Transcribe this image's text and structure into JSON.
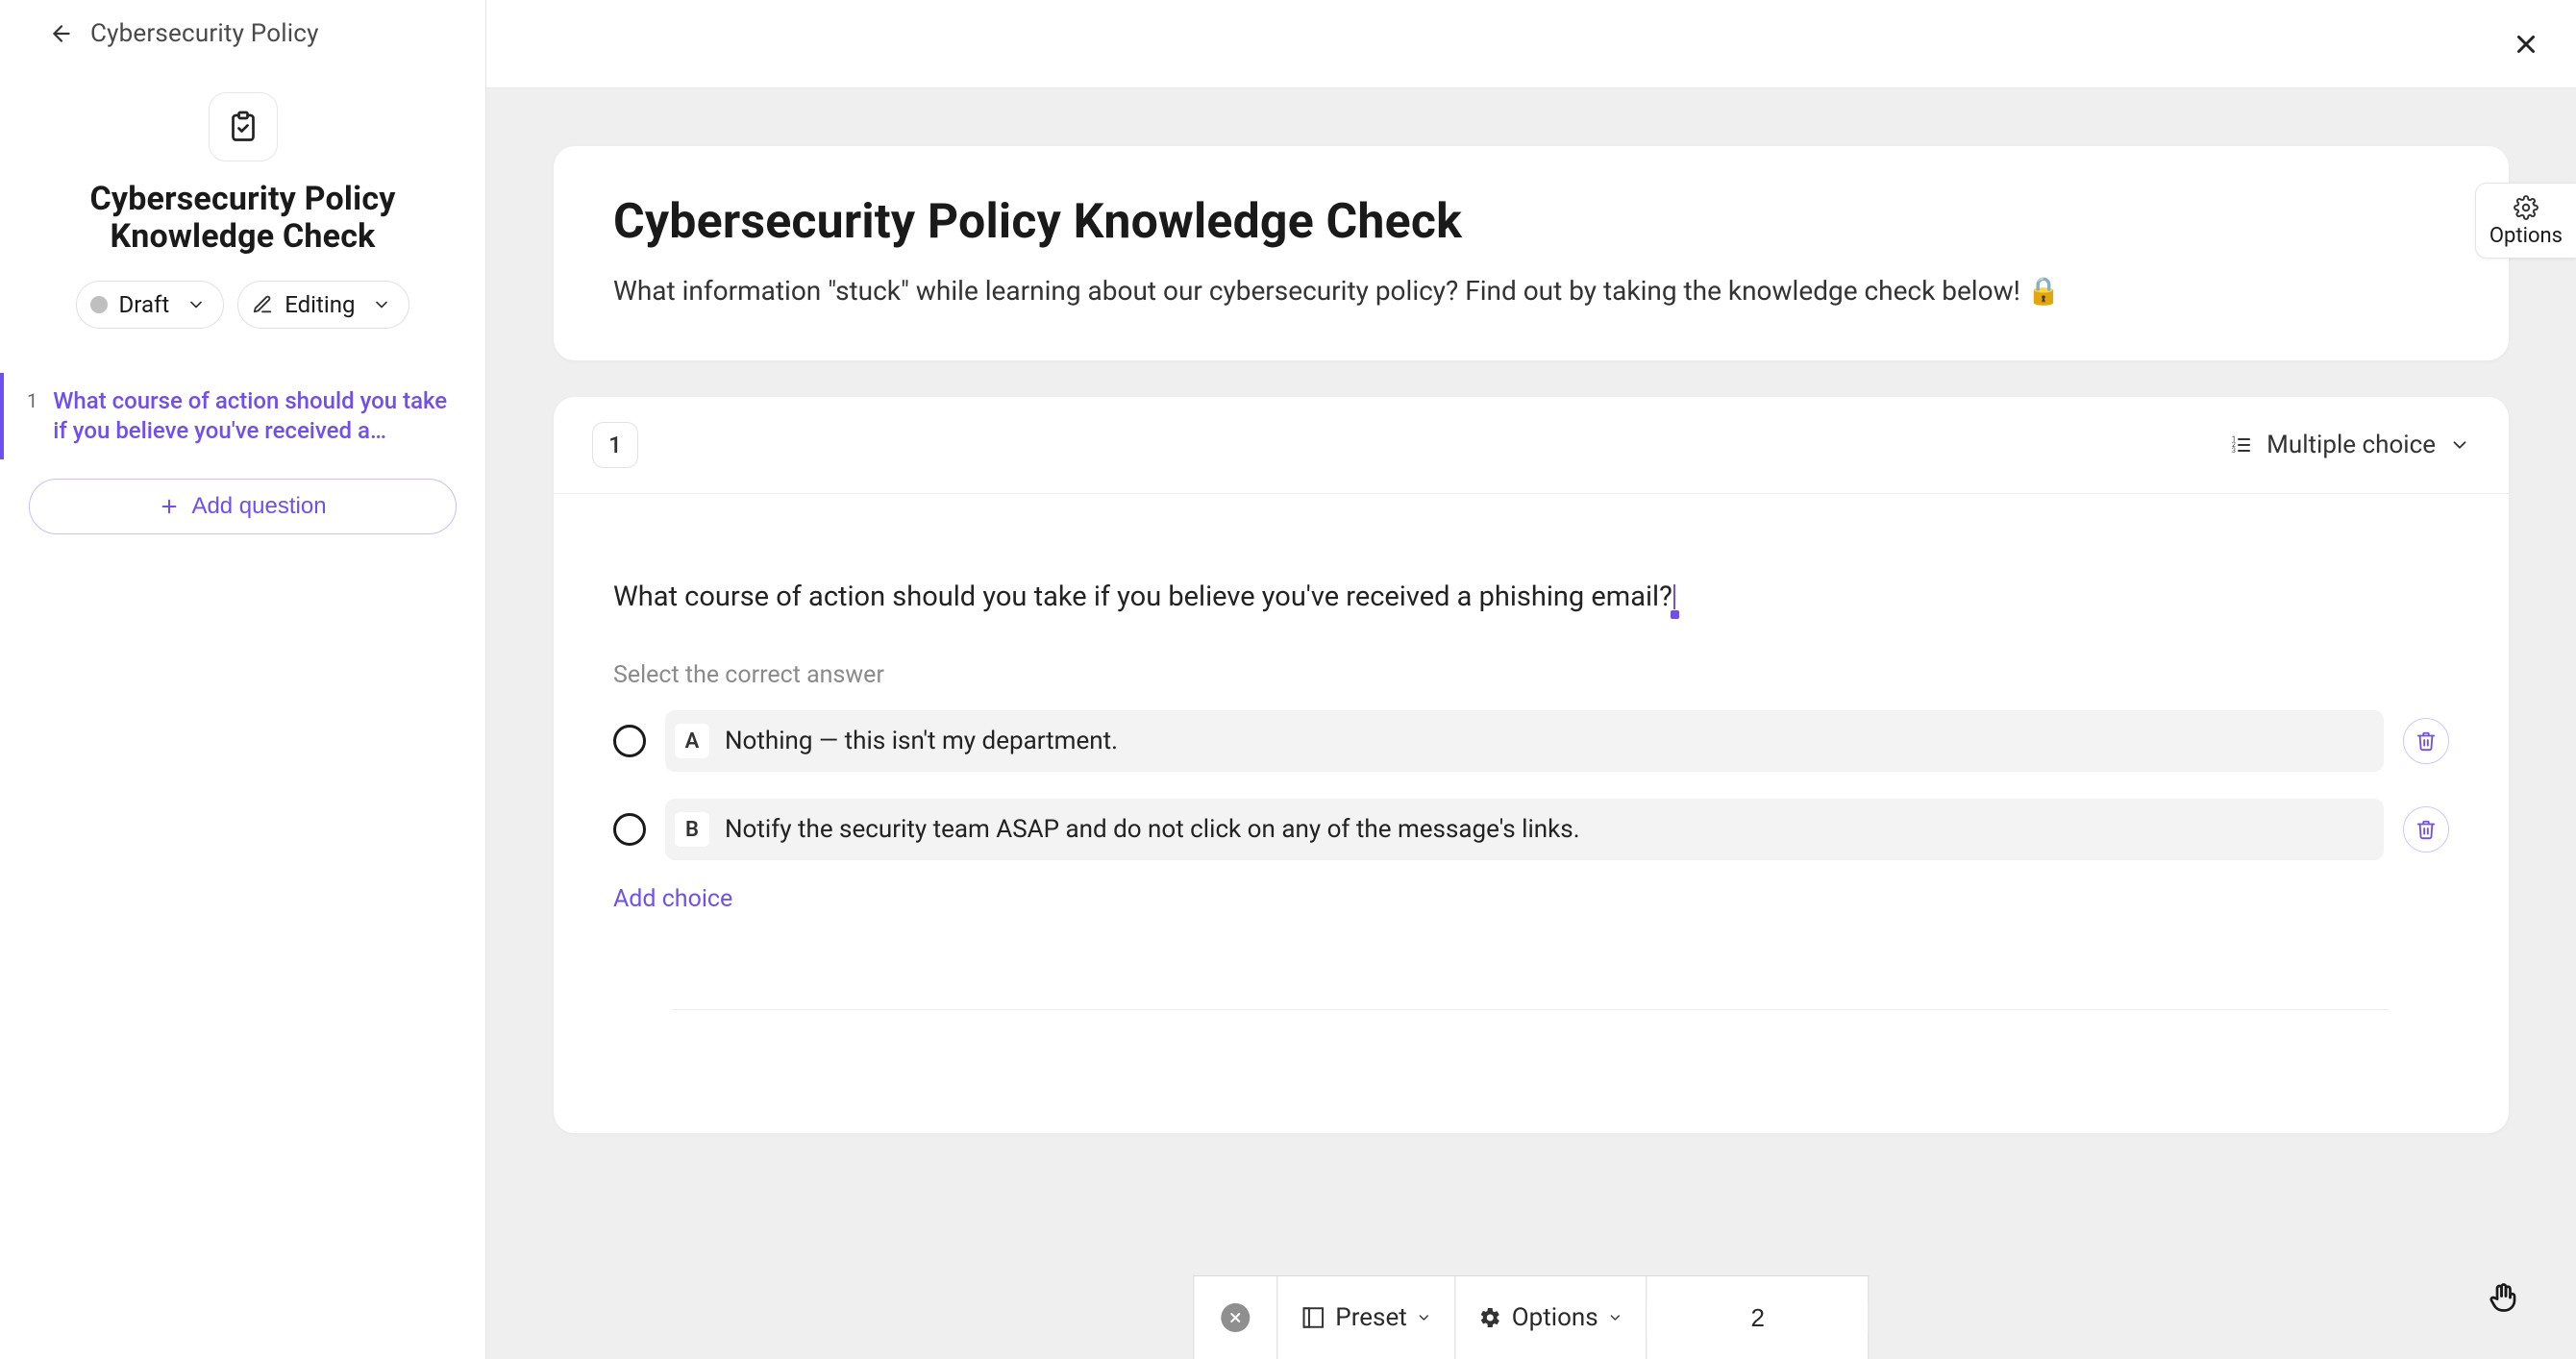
{
  "sidebar": {
    "breadcrumb": "Cybersecurity Policy",
    "title": "Cybersecurity Policy Knowledge Check",
    "status_pill": {
      "label": "Draft"
    },
    "mode_pill": {
      "label": "Editing"
    },
    "questions": [
      {
        "number": "1",
        "text": "What course of action should you take if you believe you've received a phishing email?"
      }
    ],
    "add_question_label": "Add question"
  },
  "canvas": {
    "intro": {
      "title": "Cybersecurity Policy Knowledge Check",
      "description": "What information \"stuck\" while learning about our cybersecurity policy? Find out by taking the knowledge check below! 🔒"
    },
    "question_card": {
      "number": "1",
      "type_label": "Multiple choice",
      "question_text": "What course of action should you take if you believe you've received a phishing email?",
      "select_label": "Select the correct answer",
      "choices": [
        {
          "letter": "A",
          "text": "Nothing — this isn't my department."
        },
        {
          "letter": "B",
          "text": "Notify the security team ASAP and do not click on any of the message's links."
        }
      ],
      "add_choice_label": "Add choice"
    }
  },
  "options_tab_label": "Options",
  "bottom_toolbar": {
    "preset_label": "Preset",
    "options_label": "Options",
    "page_value": "2"
  },
  "colors": {
    "accent": "#6f4ff2",
    "muted_border": "#e0e0e0",
    "canvas_bg": "#efefef"
  }
}
